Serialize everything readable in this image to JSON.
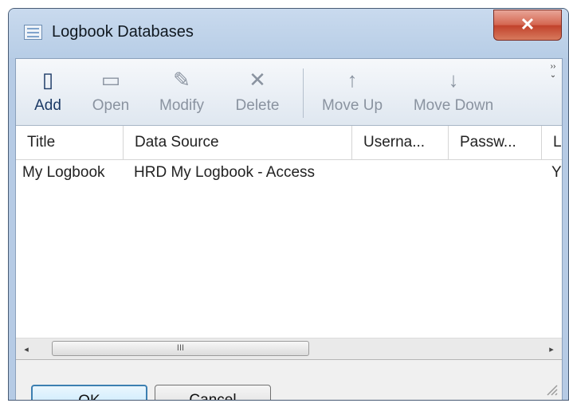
{
  "window": {
    "title": "Logbook Databases",
    "close_glyph": "✕"
  },
  "toolbar": {
    "buttons": [
      {
        "id": "add",
        "label": "Add",
        "icon": "new-document-icon",
        "glyph": "▯",
        "enabled": true
      },
      {
        "id": "open",
        "label": "Open",
        "icon": "open-folder-icon",
        "glyph": "▭",
        "enabled": false
      },
      {
        "id": "modify",
        "label": "Modify",
        "icon": "modify-icon",
        "glyph": "✎",
        "enabled": false
      },
      {
        "id": "delete",
        "label": "Delete",
        "icon": "delete-icon",
        "glyph": "✕",
        "enabled": false
      },
      {
        "id": "move-up",
        "label": "Move Up",
        "icon": "arrow-up-icon",
        "glyph": "↑",
        "enabled": false
      },
      {
        "id": "move-down",
        "label": "Move Down",
        "icon": "arrow-down-icon",
        "glyph": "↓",
        "enabled": false
      }
    ],
    "overflow_glyph": "›› ⌄"
  },
  "table": {
    "columns": [
      "Title",
      "Data Source",
      "Userna...",
      "Passw...",
      "L"
    ],
    "rows": [
      {
        "title": "My Logbook",
        "data_source": "HRD My Logbook - Access",
        "username": "",
        "password": "",
        "l": "Y"
      }
    ]
  },
  "scrollbar": {
    "left_glyph": "◂",
    "right_glyph": "▸",
    "thumb_grip": "III"
  },
  "buttons": {
    "ok": "OK",
    "cancel": "Cancel"
  },
  "colors": {
    "titlebar": "#b9cfe8",
    "close": "#c7432d",
    "accent_default_button": "#3c7fb1"
  }
}
